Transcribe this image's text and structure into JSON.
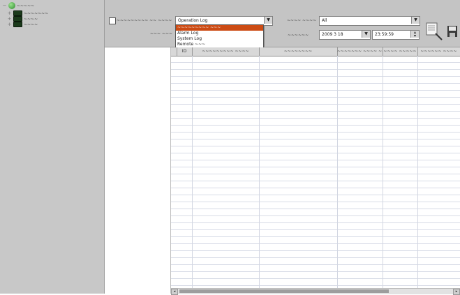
{
  "tree": {
    "root": {
      "label": "~~~~~",
      "icon": "root-globe-icon"
    },
    "devices": [
      {
        "label": "~~~~~~~"
      },
      {
        "label": "~~~~"
      },
      {
        "label": "~~~~"
      }
    ]
  },
  "toolbar": {
    "log_checkbox_label": "~~~~~~~~~ ~~ ~~~~",
    "log_type_label": "~~~ ~~~",
    "log_type_value": "Operation Log",
    "log_type_options": [
      "~~~~~~~~~ ~~~",
      "Alarm Log",
      "System Log",
      "Remote ~~~"
    ],
    "field1_label": "~~~~ ~~~~",
    "field1_value": "All",
    "field2_label": "~~~~~~",
    "date_value": "2009 3 18",
    "time_value": "23:59:59",
    "save_icon": "save-disk-icon",
    "search_icon": "search-icon"
  },
  "grid": {
    "columns": [
      "ID",
      "~~~~~~~~~ ~~~~",
      "~~~~~~~~",
      "~~~~~~~ ~~~~ ~~~~",
      "~~~~ ~~~~~",
      "~~~~~~ ~~~~"
    ]
  }
}
